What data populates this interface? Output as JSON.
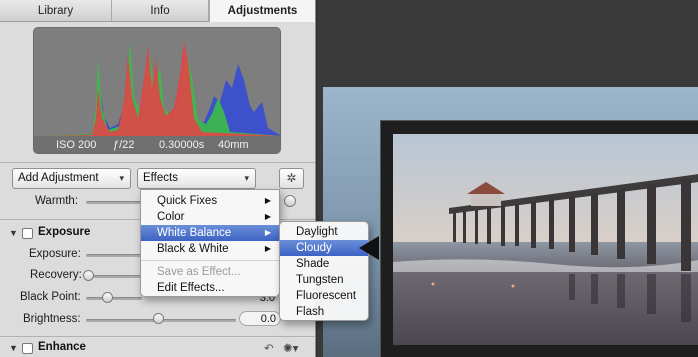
{
  "tabs": [
    {
      "label": "Library"
    },
    {
      "label": "Info"
    },
    {
      "label": "Adjustments"
    }
  ],
  "histogram": {
    "iso": "ISO 200",
    "aperture": "ƒ/22",
    "shutter": "0.30000s",
    "focal": "40mm"
  },
  "toolbar": {
    "add_adjustment": "Add Adjustment",
    "effects": "Effects"
  },
  "warmth": {
    "label": "Warmth:"
  },
  "exposure_section": {
    "title": "Exposure",
    "rows": [
      {
        "label": "Exposure:",
        "value": ""
      },
      {
        "label": "Recovery:",
        "value": ""
      },
      {
        "label": "Black Point:",
        "value": "3.0"
      },
      {
        "label": "Brightness:",
        "value": "0.0"
      }
    ]
  },
  "enhance_section": {
    "title": "Enhance"
  },
  "effects_menu": {
    "items": [
      {
        "label": "Quick Fixes",
        "submenu": true
      },
      {
        "label": "Color",
        "submenu": true
      },
      {
        "label": "White Balance",
        "submenu": true,
        "selected": true
      },
      {
        "label": "Black & White",
        "submenu": true
      },
      {
        "label": "Save as Effect...",
        "disabled": true
      },
      {
        "label": "Edit Effects..."
      }
    ]
  },
  "white_balance_menu": {
    "items": [
      {
        "label": "Daylight"
      },
      {
        "label": "Cloudy",
        "selected": true
      },
      {
        "label": "Shade"
      },
      {
        "label": "Tungsten"
      },
      {
        "label": "Fluorescent"
      },
      {
        "label": "Flash"
      }
    ]
  },
  "colors": {
    "selection": "#3c63c4",
    "panel": "#dcdcdc",
    "viewer": "#3a3a3a"
  }
}
